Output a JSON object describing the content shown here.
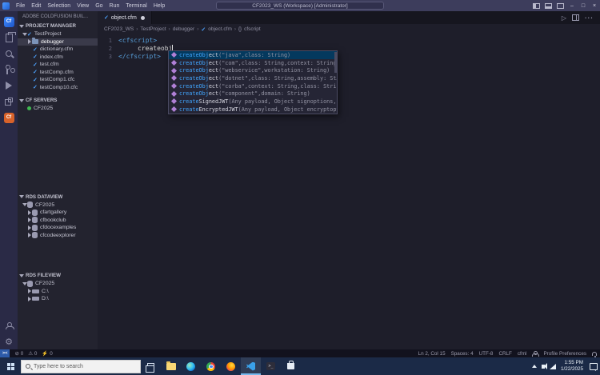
{
  "titlebar": {
    "menus": [
      "File",
      "Edit",
      "Selection",
      "View",
      "Go",
      "Run",
      "Terminal",
      "Help"
    ],
    "title": "CF2023_WS (Workspace) [Administrator]"
  },
  "activity": {
    "logo": "Cf",
    "cf_ext": "Cf"
  },
  "sidebar": {
    "app_title": "ADOBE COLDFUSION BUIL...",
    "sections": {
      "project_manager": "PROJECT MANAGER",
      "cf_servers": "CF SERVERS",
      "rds_dataview": "RDS DATAVIEW",
      "rds_fileview": "RDS FILEVIEW"
    },
    "project_items": [
      "TestProject",
      "debugger",
      "dictionary.cfm",
      "index.cfm",
      "test.cfm",
      "testComp.cfm",
      "testComp1.cfc",
      "testComp10.cfc"
    ],
    "server_items": [
      "CF2025"
    ],
    "dataview_items": [
      "CF2025",
      "cfartgallery",
      "cfbookclub",
      "cfdocexamples",
      "cfcodeexplorer"
    ],
    "fileview_items": [
      "CF2025",
      "C:\\",
      "D:\\"
    ]
  },
  "editor": {
    "tab_label": "object.cfm",
    "breadcrumbs": [
      "CF2023_WS",
      "TestProject",
      "debugger",
      "object.cfm",
      "cfscript"
    ],
    "lines": {
      "l1": {
        "num": "1",
        "text": "<cfscript>"
      },
      "l2": {
        "num": "2",
        "text": "createobj"
      },
      "l3": {
        "num": "3",
        "text": "</cfscript>"
      }
    },
    "suggestions": [
      {
        "match": "createObj",
        "rest": "ect",
        "detail": "(\"java\",class: String)"
      },
      {
        "match": "createObj",
        "rest": "ect",
        "detail": "(\"com\",class: String,context: String,…"
      },
      {
        "match": "createObj",
        "rest": "ect",
        "detail": "(\"webservice\",workstation: String)"
      },
      {
        "match": "createObj",
        "rest": "ect",
        "detail": "(\"dotnet\",class: String,assembly: St…"
      },
      {
        "match": "createObj",
        "rest": "ect",
        "detail": "(\"corba\",context: String,class: Strin…"
      },
      {
        "match": "createObj",
        "rest": "ect",
        "detail": "(\"component\",domain: String)"
      },
      {
        "match": "create",
        "rest": "SignedJWT",
        "detail": "(Any payload, Object signoptions, …"
      },
      {
        "match": "create",
        "rest": "EncryptedJWT",
        "detail": "(Any payload, Object encryptopt…"
      }
    ]
  },
  "statusbar": {
    "errors": "0",
    "warnings": "0",
    "tasks": "0",
    "line_col": "Ln 2, Col 15",
    "spaces": "Spaces: 4",
    "encoding": "UTF-8",
    "eol": "CRLF",
    "language": "cfml",
    "profile": "Profile Preferences"
  },
  "taskbar": {
    "search_placeholder": "Type here to search",
    "time": "1:55 PM",
    "date": "1/22/2025"
  }
}
